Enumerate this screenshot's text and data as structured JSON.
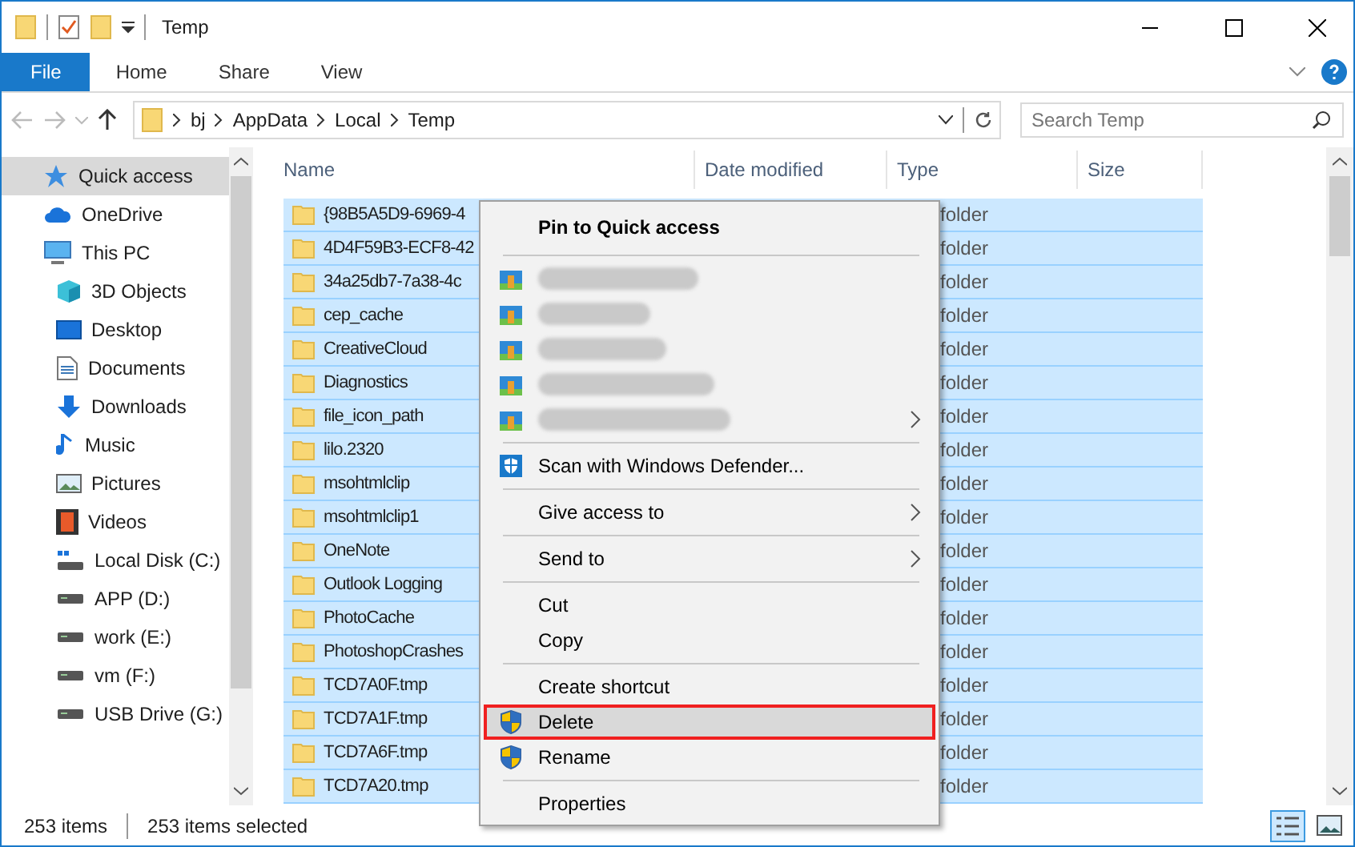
{
  "window": {
    "title": "Temp"
  },
  "ribbon_tabs": [
    {
      "label": "File",
      "selected": true
    },
    {
      "label": "Home",
      "selected": false
    },
    {
      "label": "Share",
      "selected": false
    },
    {
      "label": "View",
      "selected": false
    }
  ],
  "address": {
    "crumbs": [
      "bj",
      "AppData",
      "Local",
      "Temp"
    ],
    "search_placeholder": "Search Temp"
  },
  "sidebar": {
    "items": [
      {
        "label": "Quick access",
        "kind": "star",
        "selected": true
      },
      {
        "label": "OneDrive",
        "kind": "cloud",
        "selected": false
      },
      {
        "label": "This PC",
        "kind": "pc",
        "selected": false,
        "children": [
          {
            "label": "3D Objects",
            "kind": "cube",
            "selected": false
          },
          {
            "label": "Desktop",
            "kind": "desktop",
            "selected": false
          },
          {
            "label": "Documents",
            "kind": "documents",
            "selected": false
          },
          {
            "label": "Downloads",
            "kind": "downloads",
            "selected": false
          },
          {
            "label": "Music",
            "kind": "music",
            "selected": false
          },
          {
            "label": "Pictures",
            "kind": "pictures",
            "selected": false
          },
          {
            "label": "Videos",
            "kind": "videos",
            "selected": false
          },
          {
            "label": "Local Disk (C:)",
            "kind": "system-disk",
            "selected": false
          },
          {
            "label": "APP (D:)",
            "kind": "drive",
            "selected": false
          },
          {
            "label": "work (E:)",
            "kind": "drive",
            "selected": false
          },
          {
            "label": "vm (F:)",
            "kind": "drive",
            "selected": false
          },
          {
            "label": "USB Drive (G:)",
            "kind": "drive",
            "selected": false
          }
        ]
      }
    ]
  },
  "files": {
    "columns": [
      "Name",
      "Date modified",
      "Type",
      "Size"
    ],
    "rows": [
      {
        "name": "{98B5A5D9-6969-4",
        "type": "folder",
        "selected": true
      },
      {
        "name": "4D4F59B3-ECF8-42",
        "type": "folder",
        "selected": true
      },
      {
        "name": "34a25db7-7a38-4c",
        "type": "folder",
        "selected": true
      },
      {
        "name": "cep_cache",
        "type": "folder",
        "selected": true
      },
      {
        "name": "CreativeCloud",
        "type": "folder",
        "selected": true
      },
      {
        "name": "Diagnostics",
        "type": "folder",
        "selected": true
      },
      {
        "name": "file_icon_path",
        "type": "folder",
        "selected": true
      },
      {
        "name": "lilo.2320",
        "type": "folder",
        "selected": true
      },
      {
        "name": "msohtmlclip",
        "type": "folder",
        "selected": true
      },
      {
        "name": "msohtmlclip1",
        "type": "folder",
        "selected": true
      },
      {
        "name": "OneNote",
        "type": "folder",
        "selected": true
      },
      {
        "name": "Outlook Logging",
        "type": "folder",
        "selected": true
      },
      {
        "name": "PhotoCache",
        "type": "folder",
        "selected": true
      },
      {
        "name": "PhotoshopCrashes",
        "type": "folder",
        "selected": true
      },
      {
        "name": "TCD7A0F.tmp",
        "type": "folder",
        "selected": true
      },
      {
        "name": "TCD7A1F.tmp",
        "type": "folder",
        "selected": true
      },
      {
        "name": "TCD7A6F.tmp",
        "type": "folder",
        "selected": true
      },
      {
        "name": "TCD7A20.tmp",
        "type": "folder",
        "selected": true
      }
    ]
  },
  "context_menu": {
    "items": [
      {
        "kind": "header",
        "label": "Pin to Quick access",
        "submenu": false,
        "selected": false
      },
      {
        "kind": "separator"
      },
      {
        "kind": "blurred",
        "submenu": false,
        "selected": false
      },
      {
        "kind": "blurred",
        "submenu": false,
        "selected": false
      },
      {
        "kind": "blurred",
        "submenu": false,
        "selected": false
      },
      {
        "kind": "blurred",
        "submenu": false,
        "selected": false
      },
      {
        "kind": "blurred",
        "submenu": true,
        "selected": false
      },
      {
        "kind": "separator"
      },
      {
        "kind": "defender",
        "label": "Scan with Windows Defender...",
        "submenu": false,
        "selected": false
      },
      {
        "kind": "separator"
      },
      {
        "kind": "plain",
        "label": "Give access to",
        "submenu": true,
        "selected": false
      },
      {
        "kind": "separator"
      },
      {
        "kind": "plain",
        "label": "Send to",
        "submenu": true,
        "selected": false
      },
      {
        "kind": "separator"
      },
      {
        "kind": "plain",
        "label": "Cut",
        "submenu": false,
        "selected": false
      },
      {
        "kind": "plain",
        "label": "Copy",
        "submenu": false,
        "selected": false
      },
      {
        "kind": "separator"
      },
      {
        "kind": "plain",
        "label": "Create shortcut",
        "submenu": false,
        "selected": false
      },
      {
        "kind": "shield",
        "label": "Delete",
        "submenu": false,
        "selected": true
      },
      {
        "kind": "shield",
        "label": "Rename",
        "submenu": false,
        "selected": false
      },
      {
        "kind": "separator"
      },
      {
        "kind": "plain",
        "label": "Properties",
        "submenu": false,
        "selected": false
      }
    ]
  },
  "status_bar": {
    "count": "253 items",
    "selection": "253 items selected"
  }
}
